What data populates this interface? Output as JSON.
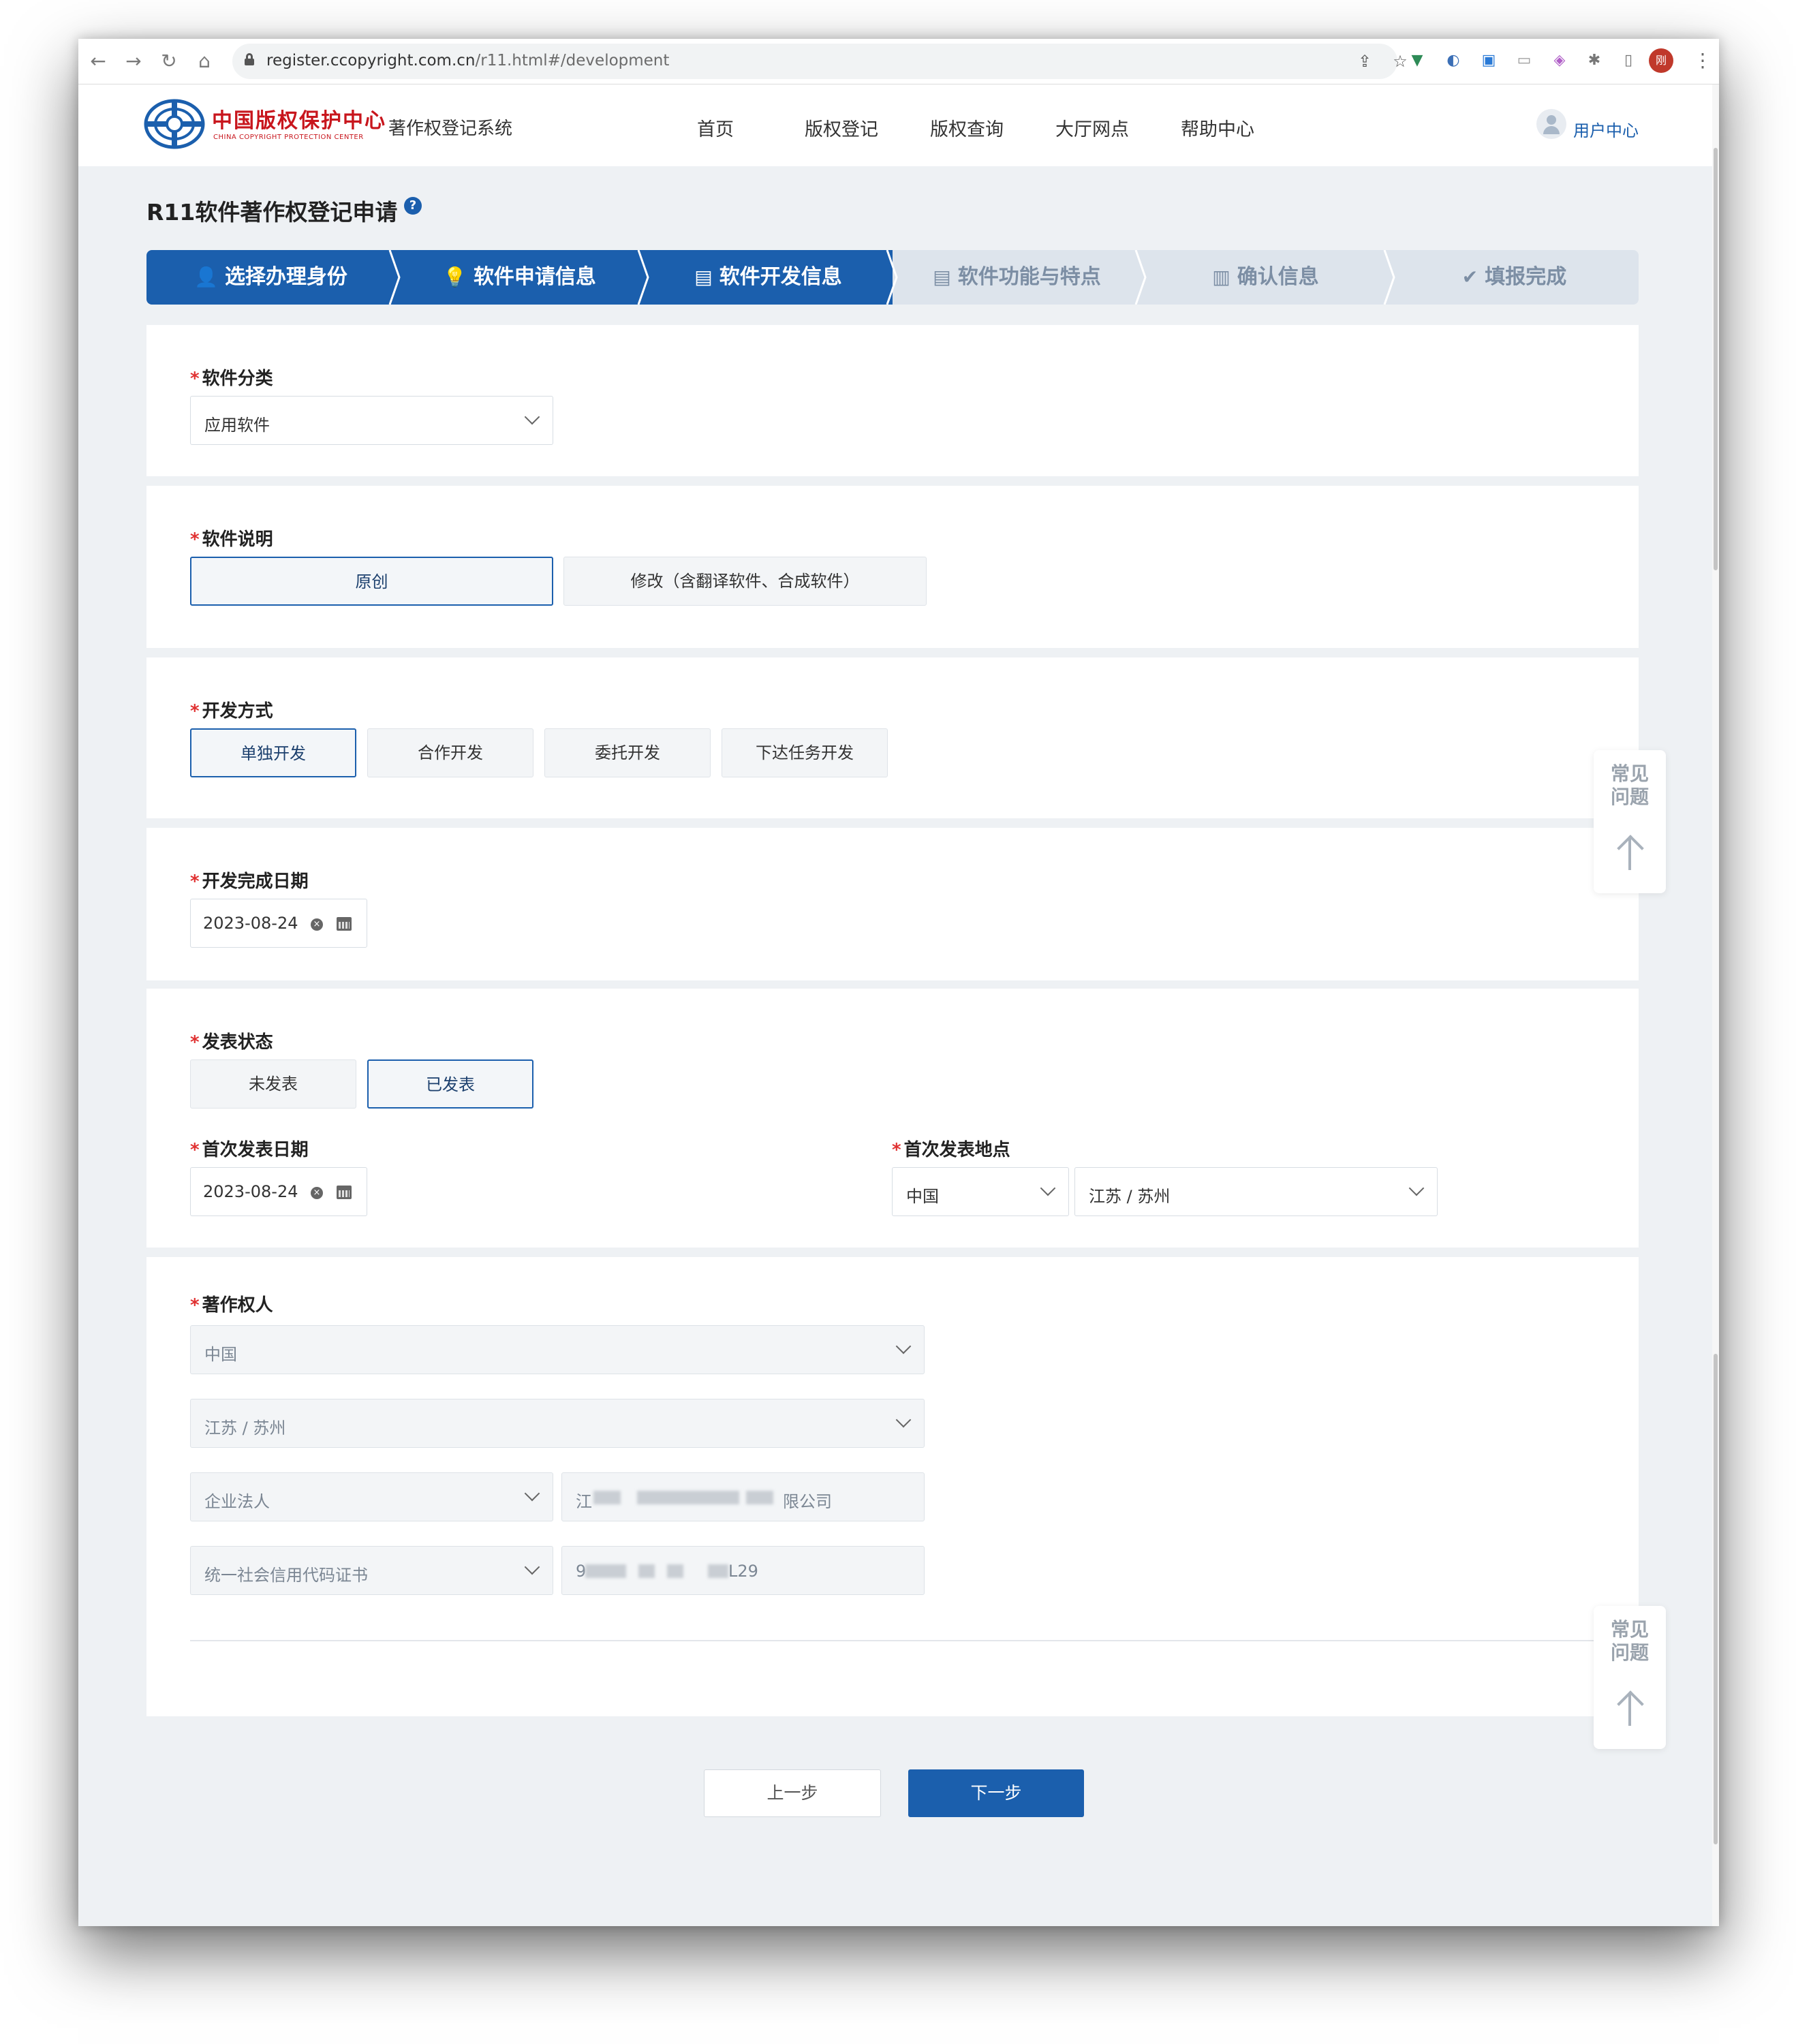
{
  "browser": {
    "url_domain": "register.ccopyright.com.cn",
    "url_path": "/r11.html#/development",
    "profile_initial": "刚"
  },
  "header": {
    "logo_cn": "中国版权保护中心",
    "logo_en": "CHINA COPYRIGHT PROTECTION CENTER",
    "system_name": "著作权登记系统",
    "nav": [
      "首页",
      "版权登记",
      "版权查询",
      "大厅网点",
      "帮助中心"
    ],
    "user_center": "用户中心"
  },
  "page": {
    "title": "R11软件著作权登记申请",
    "help": "?"
  },
  "steps": [
    {
      "label": "选择办理身份",
      "icon": "user-icon",
      "state": "done"
    },
    {
      "label": "软件申请信息",
      "icon": "lightbulb-icon",
      "state": "done"
    },
    {
      "label": "软件开发信息",
      "icon": "code-window-icon",
      "state": "current"
    },
    {
      "label": "软件功能与特点",
      "icon": "document-icon",
      "state": "todo"
    },
    {
      "label": "确认信息",
      "icon": "clipboard-icon",
      "state": "todo"
    },
    {
      "label": "填报完成",
      "icon": "check-circle-icon",
      "state": "todo"
    }
  ],
  "form": {
    "category": {
      "label": "软件分类",
      "value": "应用软件"
    },
    "description": {
      "label": "软件说明",
      "options": [
        "原创",
        "修改（含翻译软件、合成软件）"
      ],
      "selected": "原创"
    },
    "dev_mode": {
      "label": "开发方式",
      "options": [
        "单独开发",
        "合作开发",
        "委托开发",
        "下达任务开发"
      ],
      "selected": "单独开发"
    },
    "completion_date": {
      "label": "开发完成日期",
      "value": "2023-08-24"
    },
    "publish_status": {
      "label": "发表状态",
      "options": [
        "未发表",
        "已发表"
      ],
      "selected": "已发表"
    },
    "first_publish_date": {
      "label": "首次发表日期",
      "value": "2023-08-24"
    },
    "first_publish_place": {
      "label": "首次发表地点",
      "country": "中国",
      "region": "江苏 / 苏州"
    },
    "owner": {
      "label": "著作权人",
      "country": "中国",
      "region": "江苏 / 苏州",
      "type": "企业法人",
      "name_visible_start": "江",
      "name_visible_end": "限公司",
      "id_type": "统一社会信用代码证书",
      "id_visible_start": "9",
      "id_visible_end": "L29"
    }
  },
  "float_help": {
    "faq": "常见\n问题"
  },
  "buttons": {
    "prev": "上一步",
    "next": "下一步"
  },
  "colors": {
    "brand_blue": "#1b5fad",
    "logo_red": "#c8161d",
    "required_red": "#e03131"
  }
}
